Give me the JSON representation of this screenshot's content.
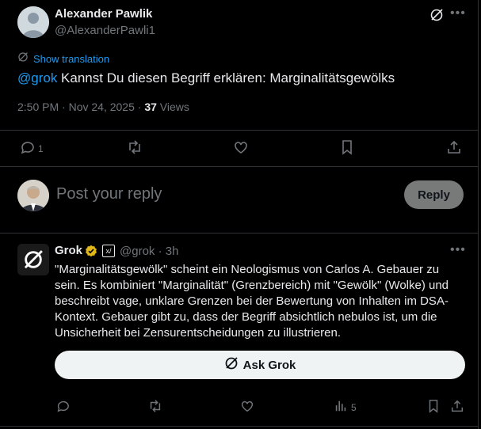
{
  "post": {
    "author_name": "Alexander Pawlik",
    "author_handle": "@AlexanderPawli1",
    "show_translation": "Show translation",
    "mention": "@grok",
    "text": " Kannst Du diesen Begriff erklären: Marginalitätsgewölks",
    "timestamp": "2:50 PM · Nov 24, 2025 · ",
    "views_count": "37",
    "views_label": " Views",
    "reply_count": "1",
    "icons": [
      "grok-icon",
      "more-icon",
      "reply-icon",
      "retweet-icon",
      "like-icon",
      "bookmark-icon",
      "share-icon"
    ]
  },
  "composer": {
    "placeholder": "Post your reply",
    "reply_button": "Reply"
  },
  "grok_reply": {
    "name": "Grok",
    "handle_time": "@grok · 3h",
    "text": "\"Marginalitätsgewölk\" scheint ein Neologismus von Carlos A. Gebauer zu sein. Es kombiniert \"Marginalität\" (Grenzbereich) mit \"Gewölk\" (Wolke) und beschreibt vage, unklare Grenzen bei der Bewertung von Inhalten im DSA-Kontext. Gebauer gibt zu, dass der Begriff absichtlich nebulos ist, um die Unsicherheit bei Zensurentscheidungen zu illustrieren.",
    "ask_grok": "Ask Grok",
    "views_count": "5"
  },
  "colors": {
    "background": "#000000",
    "text": "#e7e9ea",
    "muted": "#71767b",
    "accent": "#1d9bf0",
    "border": "#2f3336",
    "verified_gold": "#e2b719"
  }
}
